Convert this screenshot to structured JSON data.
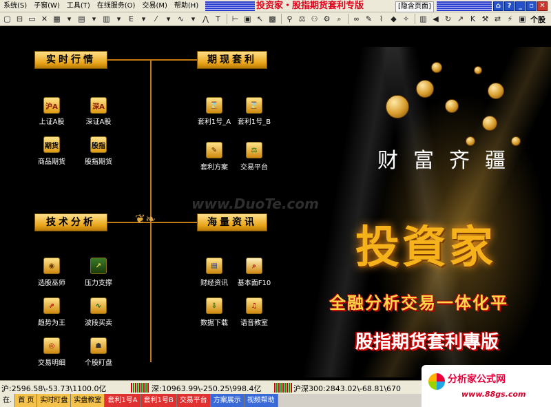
{
  "menu": {
    "items": [
      "系统(S)",
      "子窗(W)",
      "工具(T)",
      "在线服务(O)",
      "交易(M)",
      "帮助(H)"
    ]
  },
  "title": {
    "app_title": "投资家・股指期货套利专版",
    "hide_page_label": "[隐含页面]"
  },
  "window_buttons": [
    "⌂",
    "?",
    "_",
    "▫",
    "✕"
  ],
  "toolbar": {
    "stock_label": "个股"
  },
  "sections": {
    "realtime": {
      "title": "实时行情",
      "items": [
        {
          "icon": "沪A",
          "label": "上证A股"
        },
        {
          "icon": "深A",
          "label": "深证A股"
        },
        {
          "icon": "期货",
          "label": "商品期货"
        },
        {
          "icon": "股指",
          "label": "股指期货"
        }
      ]
    },
    "arbitrage": {
      "title": "期现套利",
      "items": [
        {
          "label": "套利1号_A"
        },
        {
          "label": "套利1号_B"
        },
        {
          "label": "套利方案"
        },
        {
          "label": "交易平台"
        }
      ]
    },
    "technical": {
      "title": "技术分析",
      "items": [
        {
          "label": "选股巫师"
        },
        {
          "label": "压力支撑"
        },
        {
          "label": "趋势为王"
        },
        {
          "label": "波段买卖"
        },
        {
          "label": "交易明细"
        },
        {
          "label": "个股盯盘"
        }
      ]
    },
    "news": {
      "title": "海量资讯",
      "items": [
        {
          "label": "财经资讯"
        },
        {
          "label": "基本面F10"
        },
        {
          "label": "数据下载"
        },
        {
          "label": "语音教室"
        }
      ]
    }
  },
  "banner": {
    "calligraphy": "财富齐疆",
    "brand": "投資家",
    "slogan": "全融分析交易一体化平",
    "edition": "股指期货套利專版",
    "watermark": "www.DuoTe.com"
  },
  "status": {
    "sh": "沪:2596.58\\-53.73\\1100.0亿",
    "sz": "深:10963.99\\-250.25\\998.4亿",
    "hs300": "沪深300:2843.02\\-68.81\\670"
  },
  "tabs": [
    "在.",
    "首 页",
    "实时盯盘",
    "实盘教室",
    "套利1号A",
    "套利1号B",
    "交易平台",
    "方案展示",
    "视频帮助"
  ],
  "bottom_logo": {
    "name": "分析家公式网",
    "url": "www.88gs.com"
  },
  "colors": {
    "accent_gold": "#e8a317",
    "title_red": "#e0001b",
    "brand_gold": "#f5b21a"
  }
}
